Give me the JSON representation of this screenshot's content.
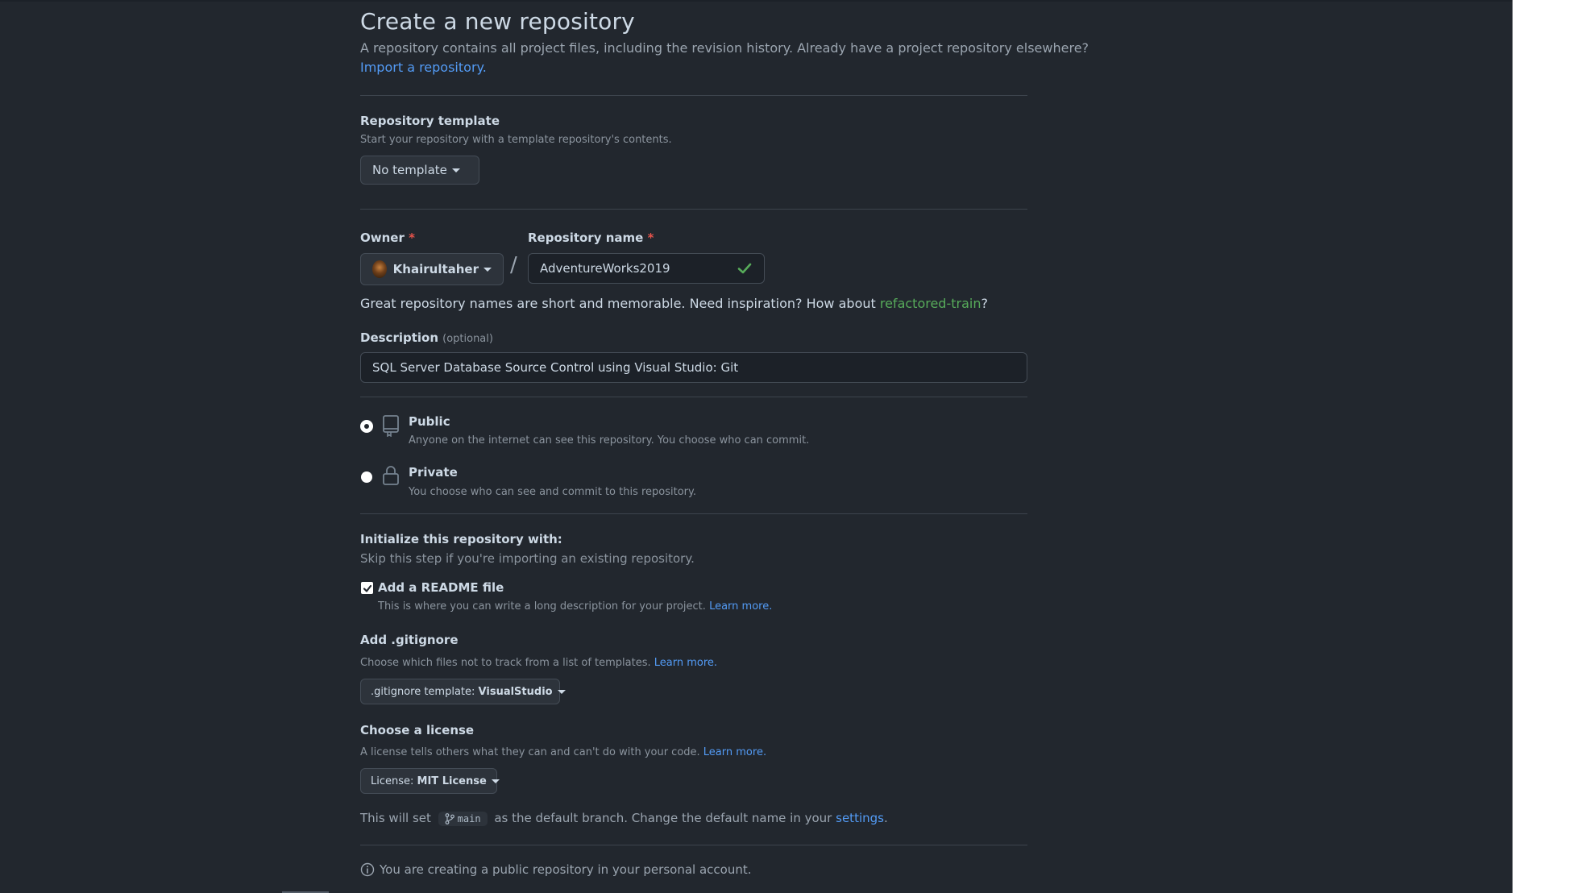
{
  "page": {
    "title": "Create a new repository",
    "lead": "A repository contains all project files, including the revision history. Already have a project repository elsewhere?",
    "import_link": "Import a repository."
  },
  "template": {
    "label": "Repository template",
    "hint": "Start your repository with a template repository's contents.",
    "button": "No template"
  },
  "owner": {
    "label": "Owner",
    "required_mark": "*",
    "value": "Khairultaher",
    "separator": "/"
  },
  "repo_name": {
    "label": "Repository name",
    "required_mark": "*",
    "value": "AdventureWorks2019",
    "valid_icon": "check-icon"
  },
  "suggestion": {
    "text": "Great repository names are short and memorable. Need inspiration? How about",
    "name": "refactored-train",
    "suffix": "?"
  },
  "description": {
    "label": "Description",
    "optional": "(optional)",
    "value": "SQL Server Database Source Control using Visual Studio: Git"
  },
  "visibility": {
    "public": {
      "label": "Public",
      "hint": "Anyone on the internet can see this repository. You choose who can commit.",
      "selected": true
    },
    "private": {
      "label": "Private",
      "hint": "You choose who can see and commit to this repository.",
      "selected": false
    }
  },
  "init": {
    "heading": "Initialize this repository with:",
    "hint": "Skip this step if you're importing an existing repository.",
    "readme": {
      "label": "Add a README file",
      "hint": "This is where you can write a long description for your project.",
      "link": "Learn more.",
      "checked": true
    },
    "gitignore": {
      "label": "Add .gitignore",
      "hint": "Choose which files not to track from a list of templates.",
      "link": "Learn more.",
      "button_prefix": ".gitignore template:",
      "button_value": "VisualStudio"
    },
    "license": {
      "label": "Choose a license",
      "hint": "A license tells others what they can and can't do with your code.",
      "link": "Learn more.",
      "button_prefix": "License:",
      "button_value": "MIT License"
    }
  },
  "branch": {
    "prefix": "This will set",
    "branch_name": "main",
    "middle": "as the default branch. Change the default name in your",
    "settings_link": "settings",
    "suffix": "."
  },
  "notice": {
    "text": "You are creating a public repository in your personal account."
  },
  "colors": {
    "background": "#22272e",
    "link": "#539bf5",
    "success": "#57ab5a",
    "danger": "#e5534b"
  }
}
